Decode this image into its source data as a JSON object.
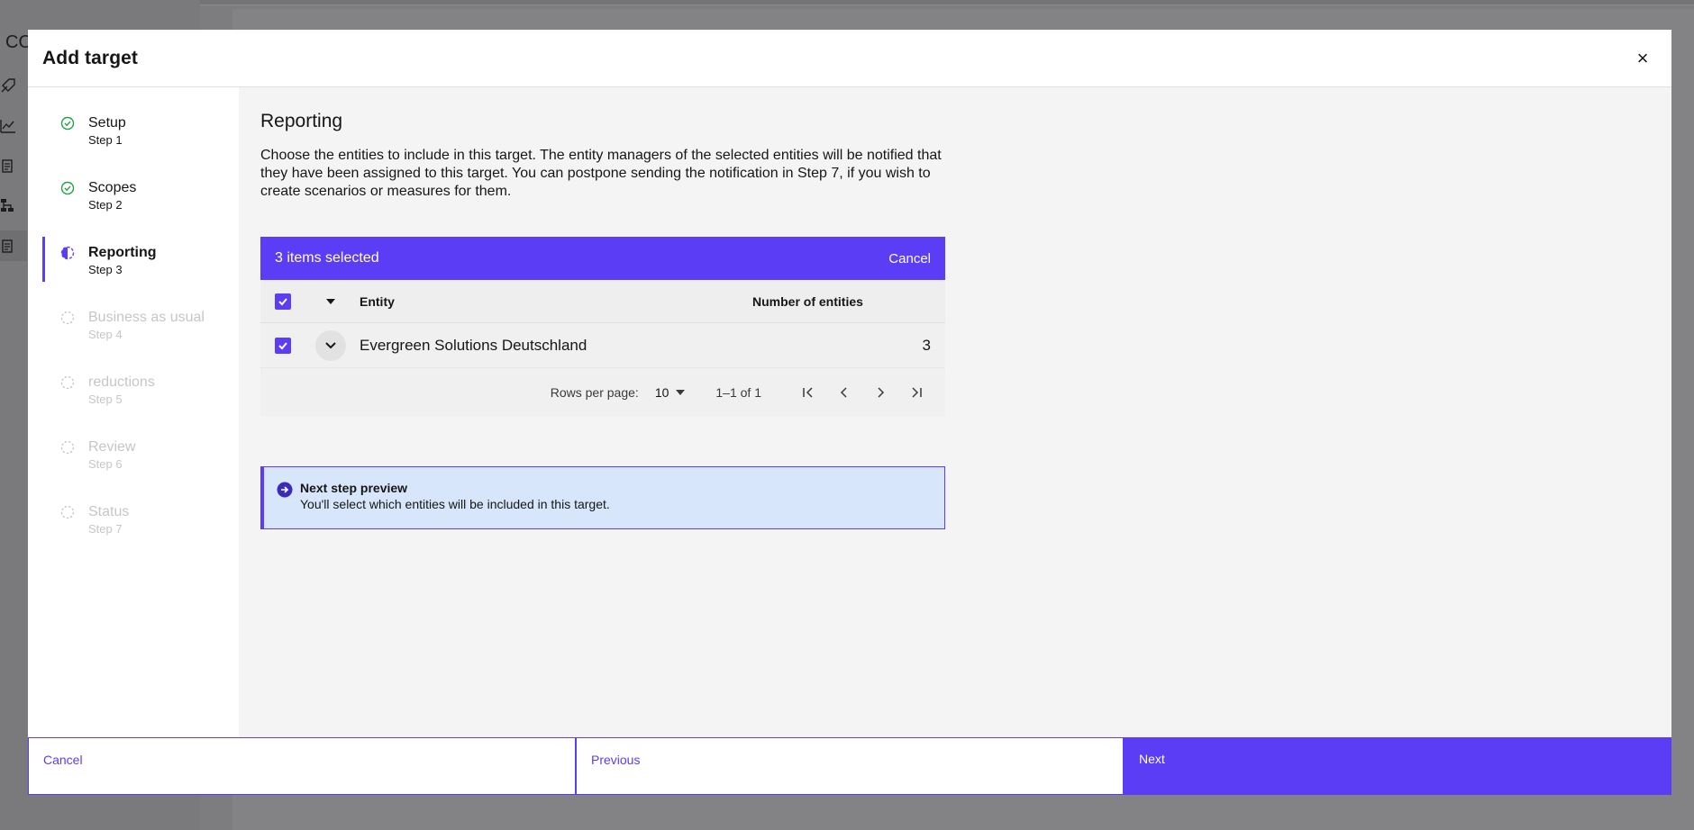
{
  "background": {
    "logo_text": "CO"
  },
  "modal": {
    "title": "Add target",
    "close_label": "×"
  },
  "steps": [
    {
      "label": "Setup",
      "sub": "Step 1",
      "state": "complete"
    },
    {
      "label": "Scopes",
      "sub": "Step 2",
      "state": "complete"
    },
    {
      "label": "Reporting",
      "sub": "Step 3",
      "state": "current"
    },
    {
      "label": "Business as usual",
      "sub": "Step 4",
      "state": "future"
    },
    {
      "label": "reductions",
      "sub": "Step 5",
      "state": "future"
    },
    {
      "label": "Review",
      "sub": "Step 6",
      "state": "future"
    },
    {
      "label": "Status",
      "sub": "Step 7",
      "state": "future"
    }
  ],
  "content": {
    "heading": "Reporting",
    "description": "Choose the entities to include in this target. The entity managers of the selected entities will be notified that they have been assigned to this target. You can postpone sending the notification in Step 7, if you wish to create scenarios or measures for them."
  },
  "table": {
    "batch_text": "3 items selected",
    "batch_cancel": "Cancel",
    "columns": {
      "entity": "Entity",
      "count": "Number of entities"
    },
    "rows": [
      {
        "entity": "Evergreen Solutions Deutschland",
        "count": "3"
      }
    ],
    "pagination": {
      "rows_per_page_label": "Rows per page:",
      "rows_per_page": "10",
      "range": "1–1 of 1"
    }
  },
  "notice": {
    "title": "Next step preview",
    "text": "You'll select which entities will be included in this target."
  },
  "footer": {
    "cancel": "Cancel",
    "previous": "Previous",
    "next": "Next"
  },
  "colors": {
    "accent": "#5a3df5",
    "success": "#24a148",
    "notice_bg": "#d7e6fb"
  }
}
